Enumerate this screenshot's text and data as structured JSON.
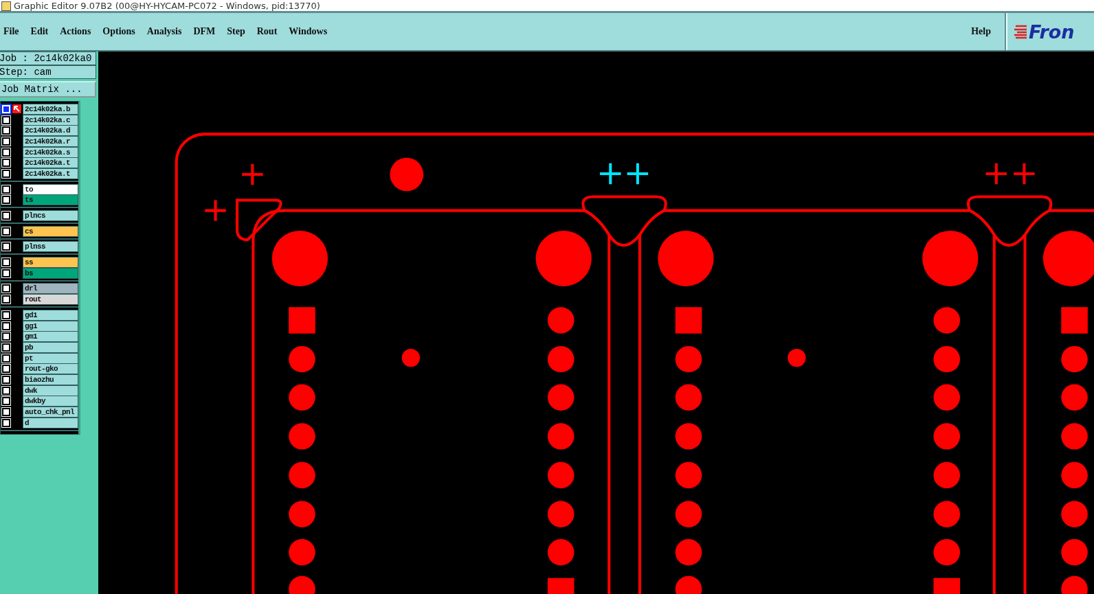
{
  "window": {
    "title": "Graphic Editor 9.07B2 (00@HY-HYCAM-PC072 - Windows, pid:13770)"
  },
  "menu": [
    {
      "label": "File"
    },
    {
      "label": "Edit"
    },
    {
      "label": "Actions"
    },
    {
      "label": "Options"
    },
    {
      "label": "Analysis"
    },
    {
      "label": "DFM"
    },
    {
      "label": "Step"
    },
    {
      "label": "Rout"
    },
    {
      "label": "Windows"
    }
  ],
  "help": "Help",
  "logo": "Fron",
  "job": "Job : 2c14k02ka0",
  "step": "Step: cam",
  "matrix_button": "Job Matrix ...",
  "layer_groups": [
    [
      {
        "name": "2c14k02ka.b",
        "color": "#9fdcdc",
        "selected": true
      },
      {
        "name": "2c14k02ka.c",
        "color": "#9fdcdc",
        "selected": false
      },
      {
        "name": "2c14k02ka.d",
        "color": "#9fdcdc",
        "selected": false
      },
      {
        "name": "2c14k02ka.r",
        "color": "#9fdcdc",
        "selected": false
      },
      {
        "name": "2c14k02ka.s",
        "color": "#9fdcdc",
        "selected": false
      },
      {
        "name": "2c14k02ka.t",
        "color": "#9fdcdc",
        "selected": false
      },
      {
        "name": "2c14k02ka.t",
        "color": "#9fdcdc",
        "selected": false
      }
    ],
    [
      {
        "name": "to",
        "color": "#ffffff",
        "selected": false
      },
      {
        "name": "ts",
        "color": "#00a57a",
        "selected": false
      }
    ],
    [
      {
        "name": "plncs",
        "color": "#9fdcdc",
        "selected": false
      }
    ],
    [
      {
        "name": "cs",
        "color": "#ffc44f",
        "selected": false
      }
    ],
    [
      {
        "name": "plnss",
        "color": "#9fdcdc",
        "selected": false
      }
    ],
    [
      {
        "name": "ss",
        "color": "#ffc44f",
        "selected": false
      },
      {
        "name": "bs",
        "color": "#00a57a",
        "selected": false
      }
    ],
    [
      {
        "name": "drl",
        "color": "#a0b4be",
        "selected": false
      },
      {
        "name": "rout",
        "color": "#d8d8d8",
        "selected": false
      }
    ],
    [
      {
        "name": "gd1",
        "color": "#9fdcdc",
        "selected": false
      },
      {
        "name": "gg1",
        "color": "#9fdcdc",
        "selected": false
      },
      {
        "name": "gm1",
        "color": "#9fdcdc",
        "selected": false
      },
      {
        "name": "pb",
        "color": "#9fdcdc",
        "selected": false
      },
      {
        "name": "pt",
        "color": "#9fdcdc",
        "selected": false
      },
      {
        "name": "rout-gko",
        "color": "#9fdcdc",
        "selected": false
      },
      {
        "name": "biaozhu",
        "color": "#9fdcdc",
        "selected": false
      },
      {
        "name": "dwk",
        "color": "#9fdcdc",
        "selected": false
      },
      {
        "name": "dwkby",
        "color": "#9fdcdc",
        "selected": false
      },
      {
        "name": "auto_chk_pnl",
        "color": "#9fdcdc",
        "selected": false
      },
      {
        "name": "d",
        "color": "#9fdcdc",
        "selected": false
      }
    ]
  ]
}
